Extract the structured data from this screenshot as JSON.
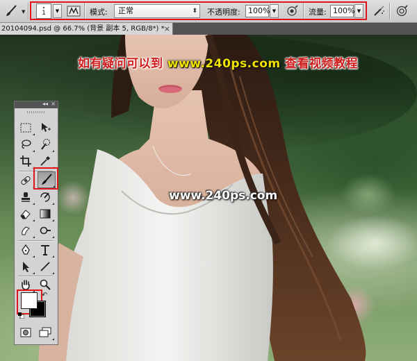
{
  "options_bar": {
    "brush_size": "1",
    "mode_label": "模式:",
    "mode_value": "正常",
    "opacity_label": "不透明度:",
    "opacity_value": "100%",
    "flow_label": "流量:",
    "flow_value": "100%",
    "icons": [
      "brush-preset-icon",
      "toggle-brush-panel-icon",
      "pressure-opacity-icon",
      "airbrush-icon",
      "pressure-size-icon"
    ]
  },
  "document_tab": {
    "title": "20104094.psd @ 66.7% (背景 副本 5, RGB/8*) *",
    "close": "×"
  },
  "canvas": {
    "watermark_top_prefix": "如有疑问可以到",
    "watermark_top_url": "www.240ps.com",
    "watermark_top_suffix": "查看视频教程",
    "watermark_center": "www.240ps.com"
  },
  "tools_panel": {
    "collapse": "◂◂",
    "close": "×",
    "active_tool": "brush-tool",
    "foreground_color": "#ffffff",
    "background_color": "#000000"
  },
  "colors": {
    "highlight_red": "#e0141b",
    "watermark_red": "#cf1d1d",
    "watermark_yellow": "#f0e300"
  }
}
